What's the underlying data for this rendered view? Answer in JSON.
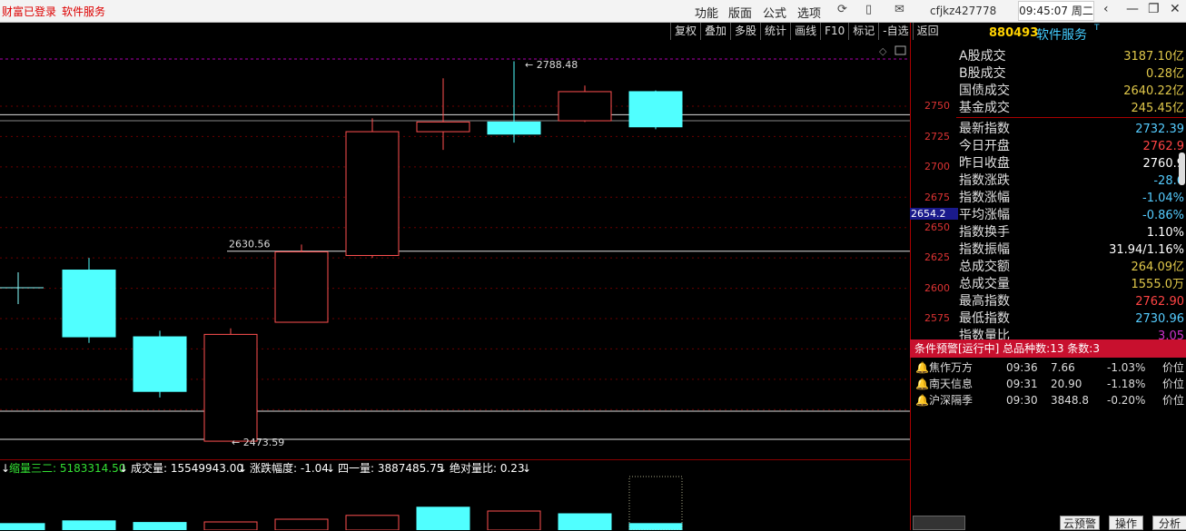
{
  "topbar": {
    "status": "财富已登录",
    "service_link": "软件服务",
    "menu": [
      "功能",
      "版面",
      "公式",
      "选项"
    ],
    "account": "cfjkz427778",
    "clock": "09:45:07 周二"
  },
  "toolbar": [
    "复权",
    "叠加",
    "多股",
    "统计",
    "画线",
    "F10",
    "标记",
    "-自选",
    "返回"
  ],
  "price_axis": {
    "ticks": [
      "2750",
      "2725",
      "2700",
      "2675",
      "2650",
      "2625",
      "2600",
      "2575"
    ],
    "highlight": "2654.2"
  },
  "chart_data": {
    "type": "candlestick",
    "high_label": "2788.48",
    "low_label": "2473.59",
    "level_label": "2630.56",
    "ylim": [
      2450,
      2800
    ],
    "candles": [
      {
        "open": 2615,
        "close": 2560,
        "high": 2625,
        "low": 2555,
        "up": false
      },
      {
        "open": 2560,
        "close": 2515,
        "high": 2565,
        "low": 2510,
        "up": false
      },
      {
        "open": 2474,
        "close": 2562,
        "high": 2567,
        "low": 2474,
        "up": true
      },
      {
        "open": 2572,
        "close": 2630,
        "high": 2636,
        "low": 2572,
        "up": true
      },
      {
        "open": 2627,
        "close": 2729,
        "high": 2740,
        "low": 2625,
        "up": true
      },
      {
        "open": 2729,
        "close": 2737,
        "high": 2773,
        "low": 2714,
        "up": true
      },
      {
        "open": 2737,
        "close": 2727,
        "high": 2787,
        "low": 2720,
        "up": false
      },
      {
        "open": 2738,
        "close": 2762,
        "high": 2767,
        "low": 2737,
        "up": true
      },
      {
        "open": 2762,
        "close": 2733,
        "high": 2763,
        "low": 2731,
        "up": false
      }
    ],
    "volumes": [
      0.12,
      0.17,
      0.14,
      0.15,
      0.2,
      0.27,
      0.42,
      0.35,
      0.3,
      0.12
    ]
  },
  "indicators": [
    {
      "text": "缩量三二: 5183314.50",
      "color": "#33e033"
    },
    {
      "text": "成交量: 15549943.00",
      "color": "#ffffff"
    },
    {
      "text": "涨跌幅度: -1.04",
      "color": "#ffffff"
    },
    {
      "text": "四一量: 3887485.75",
      "color": "#ffffff"
    },
    {
      "text": "绝对量比: 0.23",
      "color": "#ffffff"
    }
  ],
  "panel": {
    "code": "880493",
    "name": "软件服务",
    "trading": [
      {
        "k": "A股成交",
        "v": "3187.10亿",
        "c": "#e0c84a"
      },
      {
        "k": "B股成交",
        "v": "0.28亿",
        "c": "#e0c84a"
      },
      {
        "k": "国债成交",
        "v": "2640.22亿",
        "c": "#e0c84a"
      },
      {
        "k": "基金成交",
        "v": "245.45亿",
        "c": "#e0c84a"
      }
    ],
    "stats": [
      {
        "k": "最新指数",
        "v": "2732.39",
        "c": "#5cf"
      },
      {
        "k": "今日开盘",
        "v": "2762.9",
        "c": "#f44"
      },
      {
        "k": "昨日收盘",
        "v": "2760.9",
        "c": "#fff"
      },
      {
        "k": "指数涨跌",
        "v": "-28.6",
        "c": "#5cf"
      },
      {
        "k": "指数涨幅",
        "v": "-1.04%",
        "c": "#5cf"
      },
      {
        "k": "平均涨幅",
        "v": "-0.86%",
        "c": "#5cf"
      },
      {
        "k": "指数换手",
        "v": "1.10%",
        "c": "#fff"
      },
      {
        "k": "指数振幅",
        "v": "31.94/1.16%",
        "c": "#fff"
      },
      {
        "k": "总成交额",
        "v": "264.09亿",
        "c": "#e0c84a"
      },
      {
        "k": "总成交量",
        "v": "1555.0万",
        "c": "#e0c84a"
      },
      {
        "k": "最高指数",
        "v": "2762.90",
        "c": "#f44"
      },
      {
        "k": "最低指数",
        "v": "2730.96",
        "c": "#5cf"
      },
      {
        "k": "指数量比",
        "v": "3.05",
        "c": "#c3c"
      }
    ]
  },
  "warning": {
    "header": "条件预警[运行中] 总品种数:13 条数:3",
    "rows": [
      {
        "name": "焦作万方",
        "time": "09:36",
        "price": "7.66",
        "pct": "-1.03%",
        "type": "价位"
      },
      {
        "name": "南天信息",
        "time": "09:31",
        "price": "20.90",
        "pct": "-1.18%",
        "type": "价位"
      },
      {
        "name": "沪深隔季",
        "time": "09:30",
        "price": "3848.8",
        "pct": "-0.20%",
        "type": "价位"
      }
    ]
  },
  "bottom_buttons": [
    "云预警",
    "操作",
    "分析"
  ]
}
